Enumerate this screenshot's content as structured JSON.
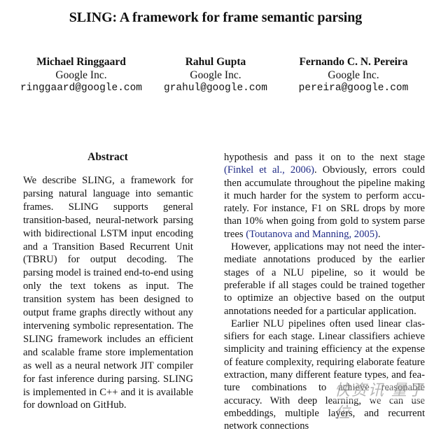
{
  "paper": {
    "title": "SLING: A framework for frame semantic parsing",
    "authors": [
      {
        "name": "Michael Ringgaard",
        "affiliation": "Google Inc.",
        "email": "ringgaard@google.com"
      },
      {
        "name": "Rahul Gupta",
        "affiliation": "Google Inc.",
        "email": "grahul@google.com"
      },
      {
        "name": "Fernando C. N. Pereira",
        "affiliation": "Google Inc.",
        "email": "pereira@google.com"
      }
    ],
    "abstract": {
      "heading": "Abstract",
      "text": "We describe SLING, a framework for parsing natural language into seman­tic frames.  SLING supports general transition-based, neural-network parsing with bidirectional LSTM input encoding and a Transition Based Recurrent Unit (TBRU) for output decoding. The parsing model is trained end-to-end using only the text tokens as input. The transition system has been designed to output frame graphs directly without any intervening symbolic representation. The SLING framework in­cludes an efficient and scalable frame store implementation as well as a neural net­work JIT compiler for fast inference dur­ing parsing.  SLING is implemented in C++ and it is available for download on GitHub."
    },
    "body": {
      "p1": {
        "text_a": "hypothesis and pass it on to the next stage ",
        "cite_a": "(Finkel et al., 2006)",
        "text_b": ".  Obviously, errors could then accumulate throughout the pipeline making it much harder for the system to perform accu­rately.  For instance, F1 on SRL drops by more than 10% when going from gold to system parse trees ",
        "cite_b": "(Toutanova and Manning, 2005)",
        "text_c": "."
      },
      "p2": "However, applications may not need the inter­mediate annotations produced by the earlier stages of a NLU pipeline, so it would be preferable if all stages could be trained together to optimize an ob­jective based on the output annotations needed for a particular application.",
      "p3": "Earlier NLU pipelines often used linear clas­sifiers for each stage.  Linear classifiers achieve simplicity and training efficiency at the expense of feature complexity, requiring elaborate feature extraction, many different feature types, and fea­ture combinations to achieve reasonable accuracy. With deep learning, we can use embeddings, mul­tiple layers, and recurrent network connections"
    },
    "colors": {
      "citation": "#1f2a86",
      "text": "#111111"
    },
    "watermark": "快资讯·量子位"
  }
}
